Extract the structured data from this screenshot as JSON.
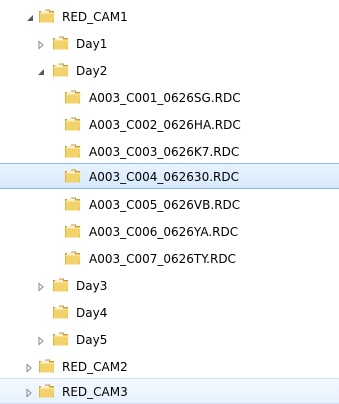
{
  "tree": {
    "items": [
      {
        "label": "RED_CAM1",
        "expander": "expanded",
        "state": "normal"
      },
      {
        "label": "Day1",
        "expander": "collapsed",
        "state": "normal"
      },
      {
        "label": "Day2",
        "expander": "expanded",
        "state": "normal"
      },
      {
        "label": "A003_C001_0626SG.RDC",
        "expander": "none",
        "state": "normal"
      },
      {
        "label": "A003_C002_0626HA.RDC",
        "expander": "none",
        "state": "normal"
      },
      {
        "label": "A003_C003_0626K7.RDC",
        "expander": "none",
        "state": "normal"
      },
      {
        "label": "A003_C004_062630.RDC",
        "expander": "none",
        "state": "selected"
      },
      {
        "label": "A003_C005_0626VB.RDC",
        "expander": "none",
        "state": "normal"
      },
      {
        "label": "A003_C006_0626YA.RDC",
        "expander": "none",
        "state": "normal"
      },
      {
        "label": "A003_C007_0626TY.RDC",
        "expander": "none",
        "state": "normal"
      },
      {
        "label": "Day3",
        "expander": "collapsed",
        "state": "normal"
      },
      {
        "label": "Day4",
        "expander": "none",
        "state": "normal"
      },
      {
        "label": "Day5",
        "expander": "collapsed",
        "state": "normal"
      },
      {
        "label": "RED_CAM2",
        "expander": "collapsed",
        "state": "normal"
      },
      {
        "label": "RED_CAM3",
        "expander": "collapsed",
        "state": "hovered"
      }
    ]
  },
  "colors": {
    "folder_body": "#f2d36b",
    "folder_dark": "#c99a2e",
    "selection_border": "#8fb8e6",
    "expander": "#595959"
  }
}
